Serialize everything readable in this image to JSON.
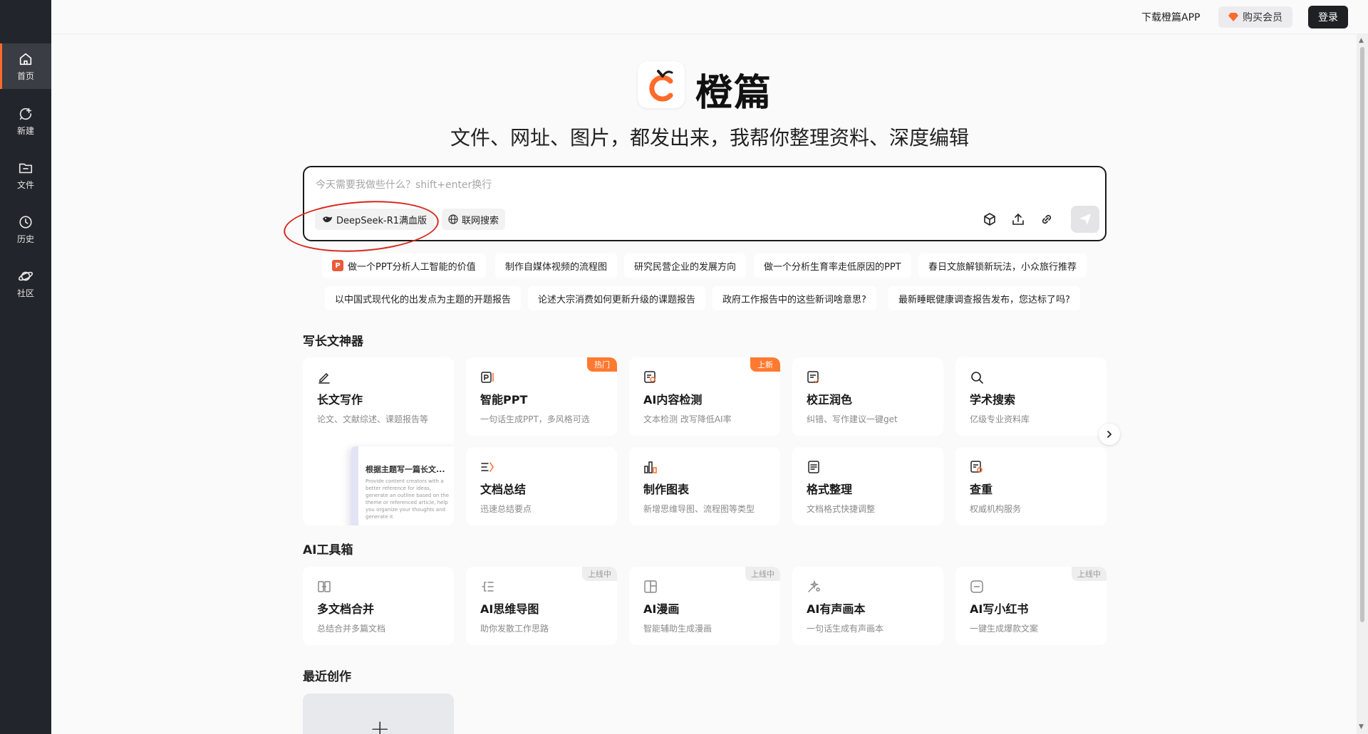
{
  "sidebar": {
    "items": [
      {
        "label": "首页",
        "icon": "home-icon"
      },
      {
        "label": "新建",
        "icon": "new-chat-icon"
      },
      {
        "label": "文件",
        "icon": "folder-icon"
      },
      {
        "label": "历史",
        "icon": "clock-icon"
      },
      {
        "label": "社区",
        "icon": "planet-icon"
      }
    ]
  },
  "topbar": {
    "download_app": "下载橙篇APP",
    "buy_vip": "购买会员",
    "login": "登录"
  },
  "hero": {
    "brand": "橙篇",
    "tagline": "文件、网址、图片，都发出来，我帮你整理资料、深度编辑"
  },
  "chatbox": {
    "placeholder": "今天需要我做些什么？shift+enter换行",
    "value": "",
    "model_label": "DeepSeek-R1满血版",
    "web_search_label": "联网搜索"
  },
  "suggestions": {
    "row1": [
      "做一个PPT分析人工智能的价值",
      "制作自媒体视频的流程图",
      "研究民营企业的发展方向",
      "做一个分析生育率走低原因的PPT",
      "春日文旅解锁新玩法，小众旅行推荐"
    ],
    "row2": [
      "以中国式现代化的出发点为主题的开题报告",
      "论述大宗消费如何更新升级的课题报告",
      "政府工作报告中的这些新词啥意思?",
      "最新睡眠健康调查报告发布，您达标了吗?"
    ],
    "ppt_badge": "P"
  },
  "long_text": {
    "title": "写长文神器",
    "cards": [
      {
        "title": "长文写作",
        "desc": "论文、文献综述、课题报告等",
        "icon": "pen-icon",
        "tag": ""
      },
      {
        "title": "智能PPT",
        "desc": "一句话生成PPT，多风格可选",
        "icon": "ppt-icon",
        "tag": "热门"
      },
      {
        "title": "AI内容检测",
        "desc": "文本检测 改写降低AI率",
        "icon": "ai-detect-icon",
        "tag": "上新"
      },
      {
        "title": "校正润色",
        "desc": "纠错、写作建议一键get",
        "icon": "proofread-icon",
        "tag": ""
      },
      {
        "title": "学术搜索",
        "desc": "亿级专业资料库",
        "icon": "search-icon",
        "tag": ""
      },
      {
        "title": "文档总结",
        "desc": "迅速总结要点",
        "icon": "summary-icon",
        "tag": ""
      },
      {
        "title": "制作图表",
        "desc": "新增思维导图、流程图等类型",
        "icon": "chart-icon",
        "tag": ""
      },
      {
        "title": "格式整理",
        "desc": "文档格式快捷调整",
        "icon": "format-icon",
        "tag": ""
      },
      {
        "title": "查重",
        "desc": "权威机构服务",
        "icon": "duplicate-check-icon",
        "tag": ""
      }
    ],
    "preview_title": "根据主题写一篇长文...",
    "preview_text": "Provide content creators with a better reference for ideas, generate an outline based on the theme or referenced article, help you organize your thoughts and generate it"
  },
  "ai_tools": {
    "title": "AI工具箱",
    "cards": [
      {
        "title": "多文档合并",
        "desc": "总结合并多篇文档",
        "icon": "merge-icon",
        "tag": ""
      },
      {
        "title": "AI思维导图",
        "desc": "助你发散工作思路",
        "icon": "mindmap-icon",
        "tag": "上线中"
      },
      {
        "title": "AI漫画",
        "desc": "智能辅助生成漫画",
        "icon": "comic-icon",
        "tag": "上线中"
      },
      {
        "title": "AI有声画本",
        "desc": "一句话生成有声画本",
        "icon": "audio-book-icon",
        "tag": ""
      },
      {
        "title": "AI写小红书",
        "desc": "一键生成爆款文案",
        "icon": "xiaohongshu-icon",
        "tag": "上线中"
      }
    ]
  },
  "recent": {
    "title": "最近创作",
    "new_label": "+"
  },
  "colors": {
    "accent": "#ff6a2b",
    "sidebar_bg": "#22252b",
    "annotation": "#d9261c"
  }
}
